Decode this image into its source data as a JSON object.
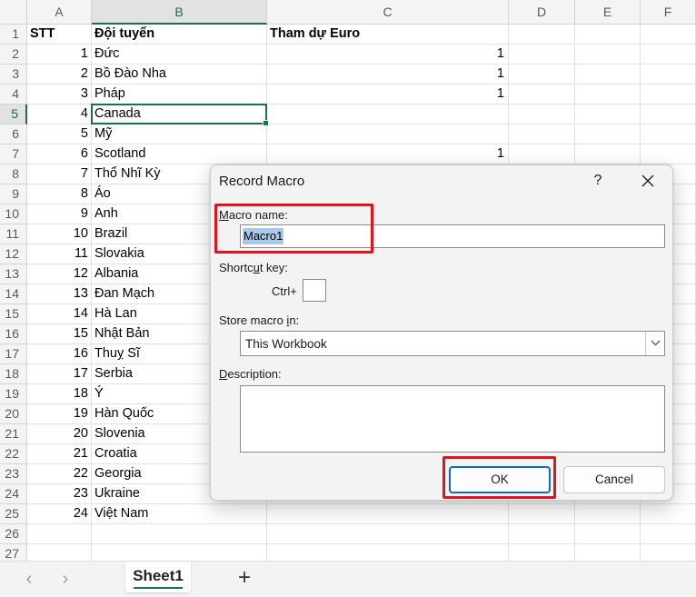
{
  "columns": [
    "A",
    "B",
    "C",
    "D",
    "E",
    "F"
  ],
  "header_row": {
    "stt": "STT",
    "team": "Đội tuyển",
    "euro": "Tham dự Euro"
  },
  "rows": [
    {
      "stt": "1",
      "team": "Đức",
      "euro": "1"
    },
    {
      "stt": "2",
      "team": "Bồ Đào Nha",
      "euro": "1"
    },
    {
      "stt": "3",
      "team": "Pháp",
      "euro": "1"
    },
    {
      "stt": "4",
      "team": "Canada",
      "euro": ""
    },
    {
      "stt": "5",
      "team": "Mỹ",
      "euro": ""
    },
    {
      "stt": "6",
      "team": "Scotland",
      "euro": "1"
    },
    {
      "stt": "7",
      "team": "Thổ Nhĩ Kỳ",
      "euro": ""
    },
    {
      "stt": "8",
      "team": "Áo",
      "euro": ""
    },
    {
      "stt": "9",
      "team": "Anh",
      "euro": ""
    },
    {
      "stt": "10",
      "team": "Brazil",
      "euro": ""
    },
    {
      "stt": "11",
      "team": "Slovakia",
      "euro": ""
    },
    {
      "stt": "12",
      "team": "Albania",
      "euro": ""
    },
    {
      "stt": "13",
      "team": "Đan Mạch",
      "euro": ""
    },
    {
      "stt": "14",
      "team": "Hà Lan",
      "euro": ""
    },
    {
      "stt": "15",
      "team": "Nhật Bản",
      "euro": ""
    },
    {
      "stt": "16",
      "team": "Thuỵ Sĩ",
      "euro": ""
    },
    {
      "stt": "17",
      "team": "Serbia",
      "euro": ""
    },
    {
      "stt": "18",
      "team": "Ý",
      "euro": ""
    },
    {
      "stt": "19",
      "team": "Hàn Quốc",
      "euro": ""
    },
    {
      "stt": "20",
      "team": "Slovenia",
      "euro": ""
    },
    {
      "stt": "21",
      "team": "Croatia",
      "euro": ""
    },
    {
      "stt": "22",
      "team": "Georgia",
      "euro": ""
    },
    {
      "stt": "23",
      "team": "Ukraine",
      "euro": ""
    },
    {
      "stt": "24",
      "team": "Việt Nam",
      "euro": ""
    }
  ],
  "row_numbers": [
    "1",
    "2",
    "3",
    "4",
    "5",
    "6",
    "7",
    "8",
    "9",
    "10",
    "11",
    "12",
    "13",
    "14",
    "15",
    "16",
    "17",
    "18",
    "19",
    "20",
    "21",
    "22",
    "23",
    "24",
    "25",
    "26",
    "27"
  ],
  "active_cell": "B5",
  "tabbar": {
    "prev_icon": "chevron-left-icon",
    "next_icon": "chevron-right-icon",
    "sheet_name": "Sheet1",
    "add_label": "+"
  },
  "dialog": {
    "title": "Record Macro",
    "help": "?",
    "close": "✕",
    "macro_name_label_first": "M",
    "macro_name_label_rest": "acro name:",
    "macro_name_value": "Macro1",
    "shortcut_label_pre": "Shortc",
    "shortcut_label_u": "u",
    "shortcut_label_post": "t key:",
    "ctrl_label": "Ctrl+",
    "shortcut_value": "",
    "store_label_pre": "Store macro ",
    "store_label_u": "i",
    "store_label_post": "n:",
    "store_value": "This Workbook",
    "desc_label_u": "D",
    "desc_label_rest": "escription:",
    "description_value": "",
    "ok_label": "OK",
    "cancel_label": "Cancel"
  },
  "colors": {
    "accent_green": "#1e7145",
    "highlight_red": "#e0141e",
    "selection_blue": "#a9c8ea",
    "ok_border": "#0f6cbd"
  }
}
